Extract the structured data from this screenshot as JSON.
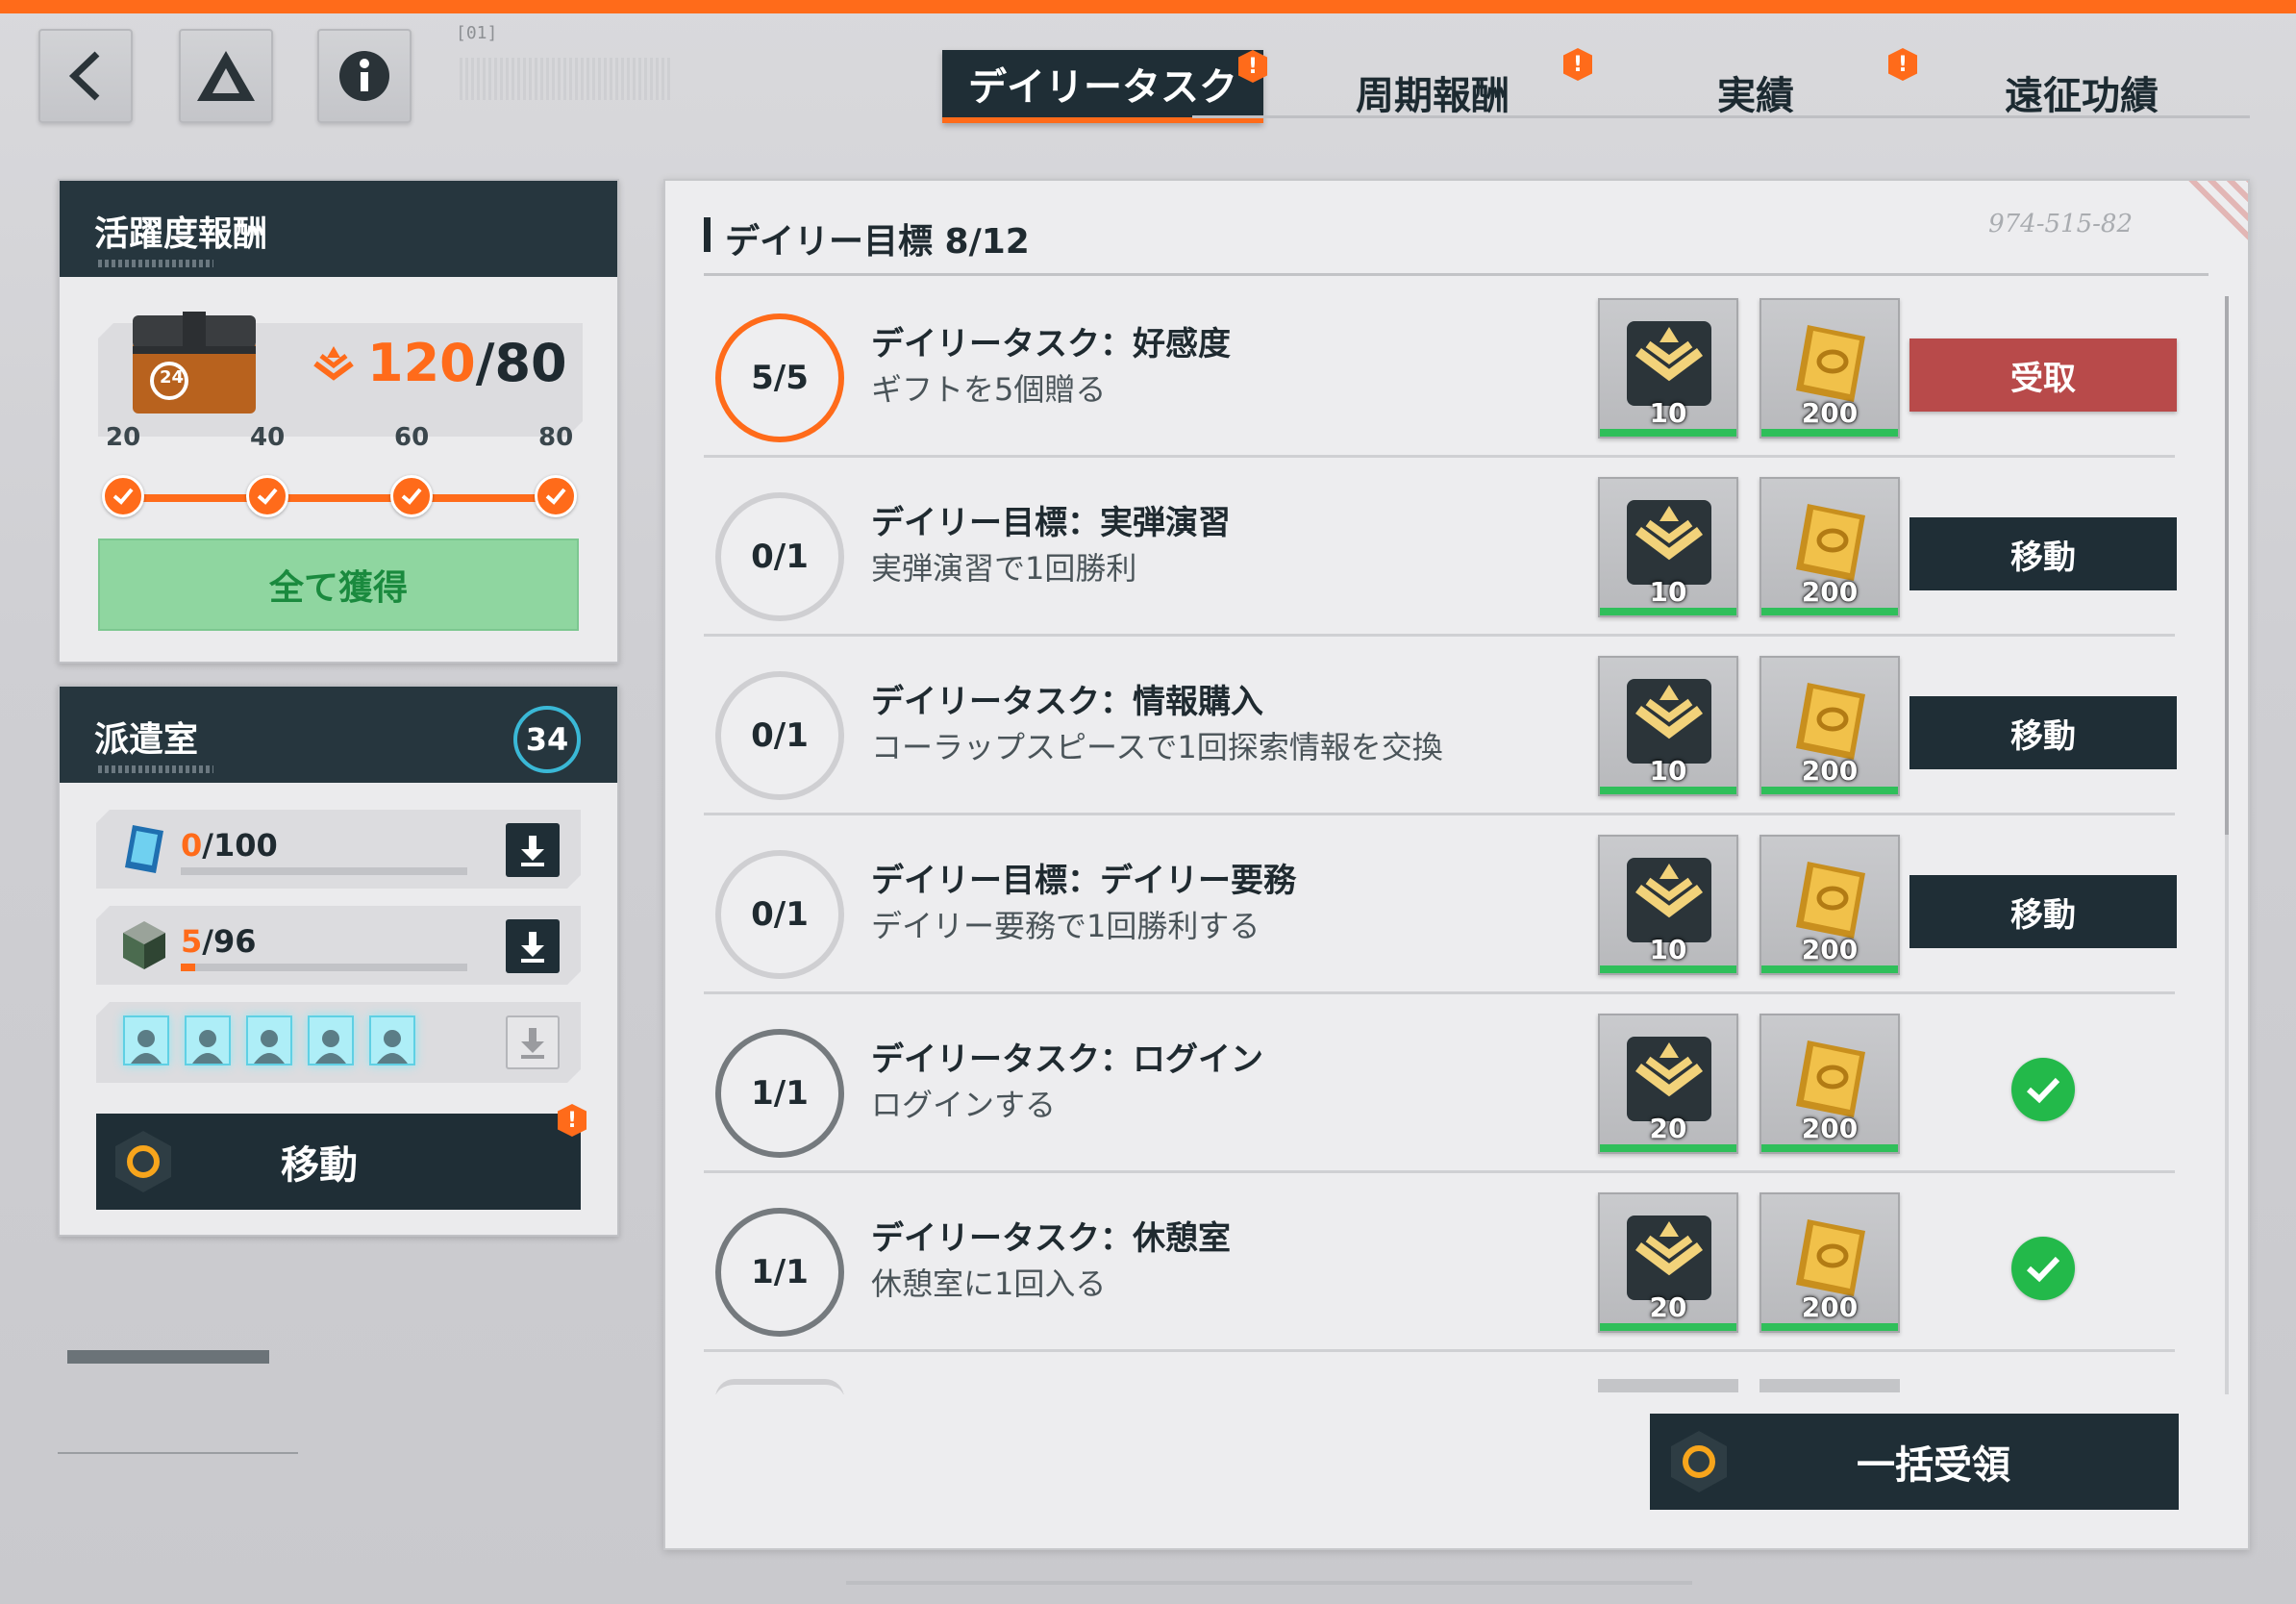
{
  "header": {
    "back_icon": "chevron-left-icon",
    "logo_icon": "triangle-logo-icon",
    "info_icon": "info-icon",
    "bracket_code": "[01]",
    "tabs": [
      {
        "label": "デイリータスク",
        "active": true,
        "badge": "!"
      },
      {
        "label": "周期報酬",
        "active": false,
        "badge": "!"
      },
      {
        "label": "実績",
        "active": false,
        "badge": "!"
      },
      {
        "label": "遠征功績",
        "active": false,
        "badge": ""
      }
    ]
  },
  "activity": {
    "title": "活躍度報酬",
    "chest_label": "24",
    "points_current": "120",
    "points_total": "/80",
    "milestones": [
      "20",
      "40",
      "60",
      "80"
    ],
    "claim_all_label": "全て獲得"
  },
  "dispatch": {
    "title": "派遣室",
    "count": "34",
    "resources": [
      {
        "current": "0",
        "max": "/100",
        "fill_fraction": 0.0
      },
      {
        "current": "5",
        "max": "/96",
        "fill_fraction": 0.05
      }
    ],
    "slots": 5,
    "move_label": "移動",
    "badge": "!"
  },
  "daily": {
    "title": "デイリー目標 8/12",
    "handwriting": "974-515-82",
    "bulk_label": "一括受領",
    "tasks": [
      {
        "progress": "5/5",
        "state": "claimable",
        "title": "デイリータスク：好感度",
        "desc": "ギフトを5個贈る",
        "reward1": "10",
        "reward2": "200",
        "action": "受取"
      },
      {
        "progress": "0/1",
        "state": "todo",
        "title": "デイリー目標：実弾演習",
        "desc": "実弾演習で1回勝利",
        "reward1": "10",
        "reward2": "200",
        "action": "移動"
      },
      {
        "progress": "0/1",
        "state": "todo",
        "title": "デイリータスク：情報購入",
        "desc": "コーラップスピースで1回探索情報を交換",
        "reward1": "10",
        "reward2": "200",
        "action": "移動"
      },
      {
        "progress": "0/1",
        "state": "todo",
        "title": "デイリー目標：デイリー要務",
        "desc": "デイリー要務で1回勝利する",
        "reward1": "10",
        "reward2": "200",
        "action": "移動"
      },
      {
        "progress": "1/1",
        "state": "done",
        "title": "デイリータスク：ログイン",
        "desc": "ログインする",
        "reward1": "20",
        "reward2": "200",
        "action": ""
      },
      {
        "progress": "1/1",
        "state": "done",
        "title": "デイリータスク：休憩室",
        "desc": "休憩室に1回入る",
        "reward1": "20",
        "reward2": "200",
        "action": ""
      }
    ]
  },
  "colors": {
    "accent": "#ff6b1a",
    "dark": "#1f2e36",
    "claim": "#b84a4a",
    "success": "#23b94a",
    "green_button": "#8fd6a0"
  }
}
